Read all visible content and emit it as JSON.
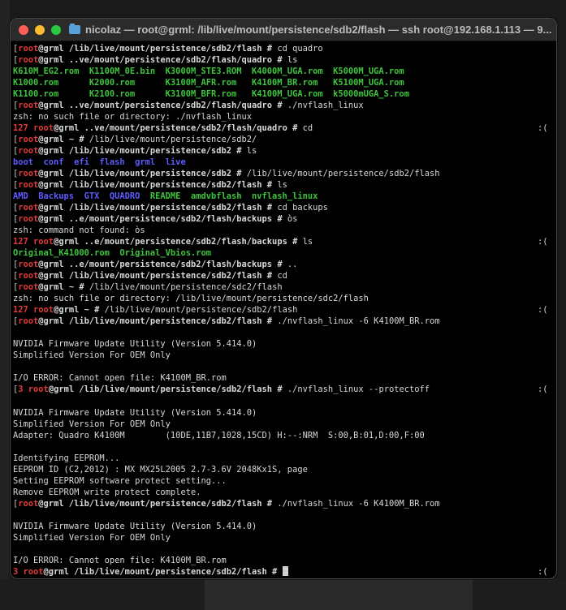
{
  "window": {
    "title": "nicolaz — root@grml: /lib/live/mount/persistence/sdb2/flash — ssh root@192.168.1.113 — 9..."
  },
  "colors": {
    "prompt_user": "#e23b3b",
    "rom_files": "#3ec43e",
    "directories": "#5c5cff",
    "background": "#000000"
  },
  "terminal_lines": [
    {
      "bracket": "[",
      "status": "",
      "user": "root",
      "host_path": "@grml /lib/live/mount/persistence/sdb2/flash # ",
      "cmd": "cd quadro"
    },
    {
      "bracket": "[",
      "status": "",
      "user": "root",
      "host_path": "@grml ..ve/mount/persistence/sdb2/flash/quadro # ",
      "cmd": "ls"
    },
    {
      "type": "green",
      "text": "K610M_EG2.rom  K1100M_0E.bin  K3000M_STE3.ROM  K4000M_UGA.rom  K5000M_UGA.rom"
    },
    {
      "type": "green",
      "text": "K1000.rom      K2000.rom      K3100M_AFR.rom   K4100M_BR.rom   K5100M_UGA.rom"
    },
    {
      "type": "green",
      "text": "K1100.rom      K2100.rom      K3100M_BFR.rom   K4100M_UGA.rom  k5000mUGA_S.rom"
    },
    {
      "bracket": "[",
      "status": "",
      "user": "root",
      "host_path": "@grml ..ve/mount/persistence/sdb2/flash/quadro # ",
      "cmd": "./nvflash_linux"
    },
    {
      "type": "plain",
      "text": "zsh: no such file or directory: ./nvflash_linux"
    },
    {
      "bracket": "",
      "status": "127 ",
      "user": "root",
      "host_path": "@grml ..ve/mount/persistence/sdb2/flash/quadro # ",
      "cmd": "cd",
      "right": ":("
    },
    {
      "bracket": "[",
      "status": "",
      "user": "root",
      "host_path": "@grml ~ # ",
      "cmd": "/lib/live/mount/persistence/sdb2/"
    },
    {
      "bracket": "[",
      "status": "",
      "user": "root",
      "host_path": "@grml /lib/live/mount/persistence/sdb2 # ",
      "cmd": "ls"
    },
    {
      "type": "blue",
      "text": "boot  conf  efi  flash  grml  live"
    },
    {
      "bracket": "[",
      "status": "",
      "user": "root",
      "host_path": "@grml /lib/live/mount/persistence/sdb2 # ",
      "cmd": "/lib/live/mount/persistence/sdb2/flash"
    },
    {
      "bracket": "[",
      "status": "",
      "user": "root",
      "host_path": "@grml /lib/live/mount/persistence/sdb2/flash # ",
      "cmd": "ls"
    },
    {
      "type": "mixed_ls",
      "blue_a": "AMD  Backups  GTX  QUADRO  ",
      "green_b": "README  amdvbflash  nvflash_linux"
    },
    {
      "bracket": "[",
      "status": "",
      "user": "root",
      "host_path": "@grml /lib/live/mount/persistence/sdb2/flash # ",
      "cmd": "cd backups"
    },
    {
      "bracket": "[",
      "status": "",
      "user": "root",
      "host_path": "@grml ..e/mount/persistence/sdb2/flash/backups # ",
      "cmd": "òs"
    },
    {
      "type": "plain",
      "text": "zsh: command not found: òs"
    },
    {
      "bracket": "",
      "status": "127 ",
      "user": "root",
      "host_path": "@grml ..e/mount/persistence/sdb2/flash/backups # ",
      "cmd": "ls",
      "right": ":("
    },
    {
      "type": "green",
      "text": "Original_K41000.rom  Original_Vbios.rom"
    },
    {
      "bracket": "[",
      "status": "",
      "user": "root",
      "host_path": "@grml ..e/mount/persistence/sdb2/flash/backups # ",
      "cmd": ".."
    },
    {
      "bracket": "[",
      "status": "",
      "user": "root",
      "host_path": "@grml /lib/live/mount/persistence/sdb2/flash # ",
      "cmd": "cd"
    },
    {
      "bracket": "[",
      "status": "",
      "user": "root",
      "host_path": "@grml ~ # ",
      "cmd": "/lib/live/mount/persistence/sdc2/flash"
    },
    {
      "type": "plain",
      "text": "zsh: no such file or directory: /lib/live/mount/persistence/sdc2/flash"
    },
    {
      "bracket": "",
      "status": "127 ",
      "user": "root",
      "host_path": "@grml ~ # ",
      "cmd": "/lib/live/mount/persistence/sdb2/flash",
      "right": ":("
    },
    {
      "bracket": "[",
      "status": "",
      "user": "root",
      "host_path": "@grml /lib/live/mount/persistence/sdb2/flash # ",
      "cmd": "./nvflash_linux -6 K4100M_BR.rom"
    },
    {
      "type": "plain",
      "text": ""
    },
    {
      "type": "plain",
      "text": "NVIDIA Firmware Update Utility (Version 5.414.0)"
    },
    {
      "type": "plain",
      "text": "Simplified Version For OEM Only"
    },
    {
      "type": "plain",
      "text": ""
    },
    {
      "type": "plain",
      "text": "I/O ERROR: Cannot open file: K4100M_BR.rom"
    },
    {
      "bracket": "[",
      "status": "3 ",
      "user": "root",
      "host_path": "@grml /lib/live/mount/persistence/sdb2/flash # ",
      "cmd": "./nvflash_linux --protectoff",
      "right": ":("
    },
    {
      "type": "plain",
      "text": ""
    },
    {
      "type": "plain",
      "text": "NVIDIA Firmware Update Utility (Version 5.414.0)"
    },
    {
      "type": "plain",
      "text": "Simplified Version For OEM Only"
    },
    {
      "type": "plain",
      "text": "Adapter: Quadro K4100M        (10DE,11B7,1028,15CD) H:--:NRM  S:00,B:01,D:00,F:00"
    },
    {
      "type": "plain",
      "text": ""
    },
    {
      "type": "plain",
      "text": "Identifying EEPROM..."
    },
    {
      "type": "plain",
      "text": "EEPROM ID (C2,2012) : MX MX25L2005 2.7-3.6V 2048Kx1S, page"
    },
    {
      "type": "plain",
      "text": "Setting EEPROM software protect setting..."
    },
    {
      "type": "plain",
      "text": "Remove EEPROM write protect complete."
    },
    {
      "bracket": "[",
      "status": "",
      "user": "root",
      "host_path": "@grml /lib/live/mount/persistence/sdb2/flash # ",
      "cmd": "./nvflash_linux -6 K4100M_BR.rom"
    },
    {
      "type": "plain",
      "text": ""
    },
    {
      "type": "plain",
      "text": "NVIDIA Firmware Update Utility (Version 5.414.0)"
    },
    {
      "type": "plain",
      "text": "Simplified Version For OEM Only"
    },
    {
      "type": "plain",
      "text": ""
    },
    {
      "type": "plain",
      "text": "I/O ERROR: Cannot open file: K4100M_BR.rom"
    },
    {
      "bracket": "",
      "status": "3 ",
      "user": "root",
      "host_path": "@grml /lib/live/mount/persistence/sdb2/flash # ",
      "cmd": "",
      "right": ":(",
      "cursor": true
    }
  ]
}
